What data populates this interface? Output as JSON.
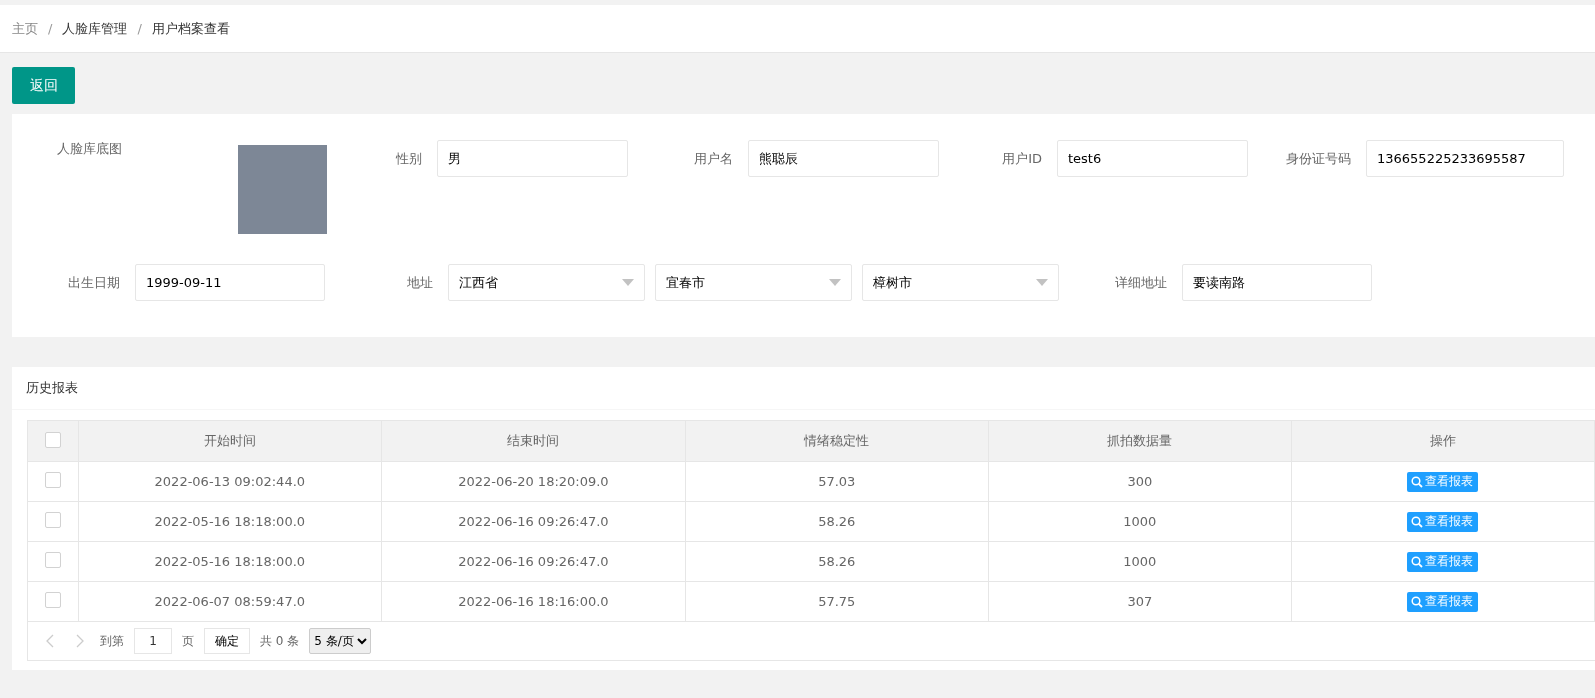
{
  "breadcrumb": [
    "主页",
    "人脸库管理",
    "用户档案查看"
  ],
  "breadcrumb_separator": "/",
  "back_button": "返回",
  "profile": {
    "photo_label": "人脸库底图",
    "row_1": [
      {
        "label": "性别",
        "value": "男"
      },
      {
        "label": "用户名",
        "value": "熊聪辰"
      },
      {
        "label": "用户ID",
        "value": "test6"
      },
      {
        "label": "身份证号码",
        "value": "136655225233695587"
      }
    ],
    "birth_date": {
      "label": "出生日期",
      "value": "1999-09-11"
    },
    "address": {
      "label": "地址",
      "selects": [
        "江西省",
        "宜春市",
        "樟树市"
      ]
    },
    "detail_address": {
      "label": "详细地址",
      "value": "要读南路"
    }
  },
  "history": {
    "title": "历史报表",
    "table": {
      "header_checked": false,
      "columns": [
        "开始时间",
        "结束时间",
        "情绪稳定性",
        "抓拍数据量",
        "操作"
      ],
      "rows": [
        {
          "checked": false,
          "cells": [
            "2022-06-13 09:02:44.0",
            "2022-06-20 18:20:09.0",
            "57.03",
            "300"
          ],
          "action": "查看报表"
        },
        {
          "checked": false,
          "cells": [
            "2022-05-16 18:18:00.0",
            "2022-06-16 09:26:47.0",
            "58.26",
            "1000"
          ],
          "action": "查看报表"
        },
        {
          "checked": false,
          "cells": [
            "2022-05-16 18:18:00.0",
            "2022-06-16 09:26:47.0",
            "58.26",
            "1000"
          ],
          "action": "查看报表"
        },
        {
          "checked": false,
          "cells": [
            "2022-06-07 08:59:47.0",
            "2022-06-16 18:16:00.0",
            "57.75",
            "307"
          ],
          "action": "查看报表"
        }
      ]
    },
    "pagination": {
      "goto_label": "到第",
      "page": "1",
      "page_unit": "页",
      "confirm": "确定",
      "total": "共 0 条",
      "page_size": "5 条/页"
    }
  }
}
